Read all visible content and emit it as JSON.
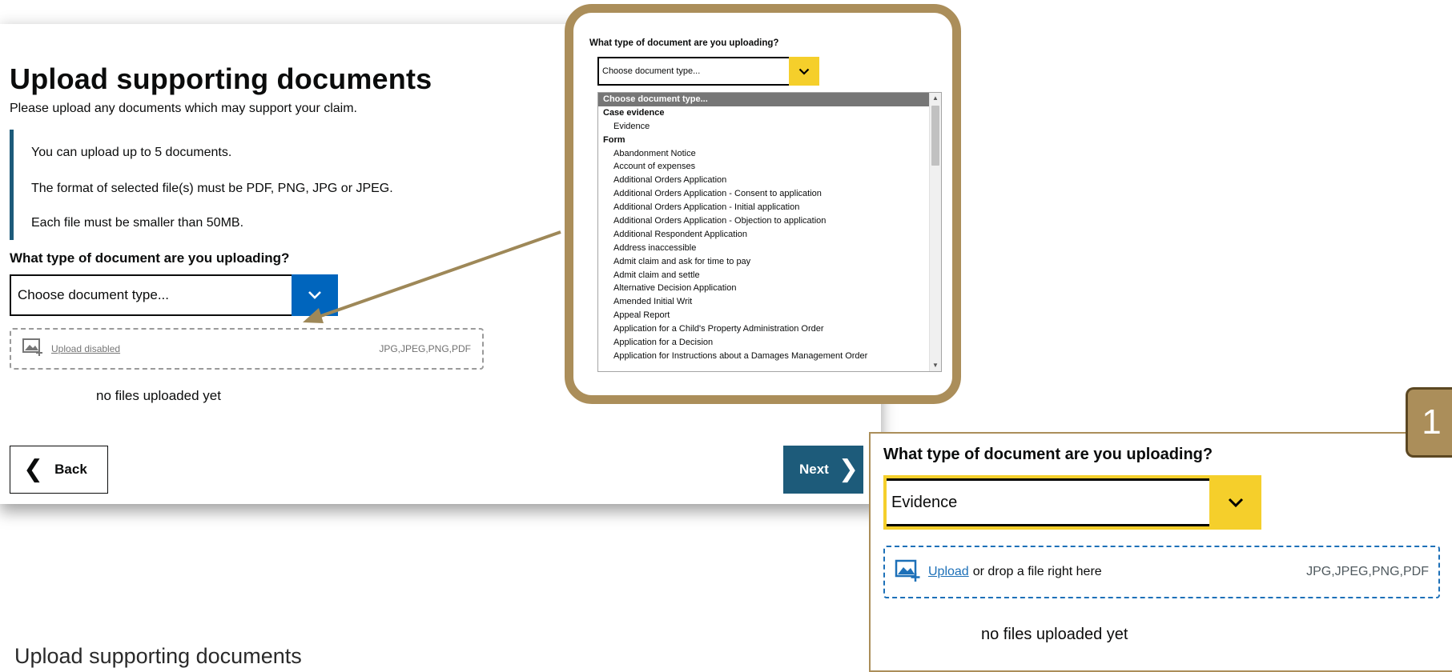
{
  "main": {
    "title": "Upload supporting documents",
    "intro": "Please upload any documents which may support your claim.",
    "info": [
      "You can upload up to 5 documents.",
      "The format of selected file(s) must be PDF, PNG, JPG or JPEG.",
      "Each file must be smaller than 50MB."
    ],
    "question": "What type of document are you uploading?",
    "select_value": "Choose document type...",
    "upload_label": "Upload disabled",
    "formats": "JPG,JPEG,PNG,PDF",
    "no_files": "no files uploaded yet",
    "back_label": "Back",
    "next_label": "Next"
  },
  "dropdown_zoom": {
    "question": "What type of document are you uploading?",
    "select_value": "Choose document type...",
    "options": [
      {
        "label": "Choose document type...",
        "kind": "selected"
      },
      {
        "label": "Case evidence",
        "kind": "group"
      },
      {
        "label": "Evidence",
        "kind": "child"
      },
      {
        "label": "Form",
        "kind": "group"
      },
      {
        "label": "Abandonment Notice",
        "kind": "child"
      },
      {
        "label": "Account of expenses",
        "kind": "child"
      },
      {
        "label": "Additional Orders Application",
        "kind": "child"
      },
      {
        "label": "Additional Orders Application - Consent to application",
        "kind": "child"
      },
      {
        "label": "Additional Orders Application - Initial application",
        "kind": "child"
      },
      {
        "label": "Additional Orders Application - Objection to application",
        "kind": "child"
      },
      {
        "label": "Additional Respondent Application",
        "kind": "child"
      },
      {
        "label": "Address inaccessible",
        "kind": "child"
      },
      {
        "label": "Admit claim and ask for time to pay",
        "kind": "child"
      },
      {
        "label": "Admit claim and settle",
        "kind": "child"
      },
      {
        "label": "Alternative Decision Application",
        "kind": "child"
      },
      {
        "label": "Amended Initial Writ",
        "kind": "child"
      },
      {
        "label": "Appeal Report",
        "kind": "child"
      },
      {
        "label": "Application for a Child's Property Administration Order",
        "kind": "child"
      },
      {
        "label": "Application for a Decision",
        "kind": "child"
      },
      {
        "label": "Application for Instructions about a Damages Management Order",
        "kind": "child"
      }
    ]
  },
  "step_zoom": {
    "step_number": "1",
    "question": "What type of document are you uploading?",
    "select_value": "Evidence",
    "upload_link": "Upload",
    "drop_text": "or drop a file right here",
    "formats": "JPG,JPEG,PNG,PDF",
    "no_files": "no files uploaded yet"
  },
  "caption": "Upload supporting documents",
  "colors": {
    "gold_frame": "#ab8e5a",
    "teal_button": "#1d5b7a",
    "blue_select": "#0065bd",
    "yellow_focus": "#f5cf2b"
  }
}
